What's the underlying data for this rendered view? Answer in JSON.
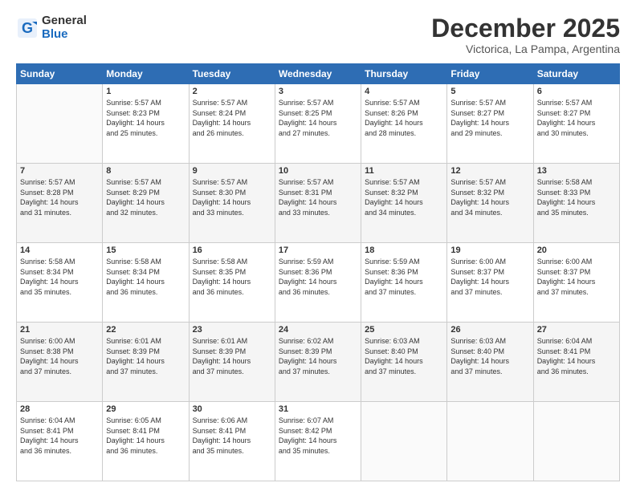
{
  "logo": {
    "general": "General",
    "blue": "Blue"
  },
  "header": {
    "month": "December 2025",
    "location": "Victorica, La Pampa, Argentina"
  },
  "days_of_week": [
    "Sunday",
    "Monday",
    "Tuesday",
    "Wednesday",
    "Thursday",
    "Friday",
    "Saturday"
  ],
  "weeks": [
    [
      {
        "num": "",
        "info": ""
      },
      {
        "num": "1",
        "info": "Sunrise: 5:57 AM\nSunset: 8:23 PM\nDaylight: 14 hours\nand 25 minutes."
      },
      {
        "num": "2",
        "info": "Sunrise: 5:57 AM\nSunset: 8:24 PM\nDaylight: 14 hours\nand 26 minutes."
      },
      {
        "num": "3",
        "info": "Sunrise: 5:57 AM\nSunset: 8:25 PM\nDaylight: 14 hours\nand 27 minutes."
      },
      {
        "num": "4",
        "info": "Sunrise: 5:57 AM\nSunset: 8:26 PM\nDaylight: 14 hours\nand 28 minutes."
      },
      {
        "num": "5",
        "info": "Sunrise: 5:57 AM\nSunset: 8:27 PM\nDaylight: 14 hours\nand 29 minutes."
      },
      {
        "num": "6",
        "info": "Sunrise: 5:57 AM\nSunset: 8:27 PM\nDaylight: 14 hours\nand 30 minutes."
      }
    ],
    [
      {
        "num": "7",
        "info": "Sunrise: 5:57 AM\nSunset: 8:28 PM\nDaylight: 14 hours\nand 31 minutes."
      },
      {
        "num": "8",
        "info": "Sunrise: 5:57 AM\nSunset: 8:29 PM\nDaylight: 14 hours\nand 32 minutes."
      },
      {
        "num": "9",
        "info": "Sunrise: 5:57 AM\nSunset: 8:30 PM\nDaylight: 14 hours\nand 33 minutes."
      },
      {
        "num": "10",
        "info": "Sunrise: 5:57 AM\nSunset: 8:31 PM\nDaylight: 14 hours\nand 33 minutes."
      },
      {
        "num": "11",
        "info": "Sunrise: 5:57 AM\nSunset: 8:32 PM\nDaylight: 14 hours\nand 34 minutes."
      },
      {
        "num": "12",
        "info": "Sunrise: 5:57 AM\nSunset: 8:32 PM\nDaylight: 14 hours\nand 34 minutes."
      },
      {
        "num": "13",
        "info": "Sunrise: 5:58 AM\nSunset: 8:33 PM\nDaylight: 14 hours\nand 35 minutes."
      }
    ],
    [
      {
        "num": "14",
        "info": "Sunrise: 5:58 AM\nSunset: 8:34 PM\nDaylight: 14 hours\nand 35 minutes."
      },
      {
        "num": "15",
        "info": "Sunrise: 5:58 AM\nSunset: 8:34 PM\nDaylight: 14 hours\nand 36 minutes."
      },
      {
        "num": "16",
        "info": "Sunrise: 5:58 AM\nSunset: 8:35 PM\nDaylight: 14 hours\nand 36 minutes."
      },
      {
        "num": "17",
        "info": "Sunrise: 5:59 AM\nSunset: 8:36 PM\nDaylight: 14 hours\nand 36 minutes."
      },
      {
        "num": "18",
        "info": "Sunrise: 5:59 AM\nSunset: 8:36 PM\nDaylight: 14 hours\nand 37 minutes."
      },
      {
        "num": "19",
        "info": "Sunrise: 6:00 AM\nSunset: 8:37 PM\nDaylight: 14 hours\nand 37 minutes."
      },
      {
        "num": "20",
        "info": "Sunrise: 6:00 AM\nSunset: 8:37 PM\nDaylight: 14 hours\nand 37 minutes."
      }
    ],
    [
      {
        "num": "21",
        "info": "Sunrise: 6:00 AM\nSunset: 8:38 PM\nDaylight: 14 hours\nand 37 minutes."
      },
      {
        "num": "22",
        "info": "Sunrise: 6:01 AM\nSunset: 8:39 PM\nDaylight: 14 hours\nand 37 minutes."
      },
      {
        "num": "23",
        "info": "Sunrise: 6:01 AM\nSunset: 8:39 PM\nDaylight: 14 hours\nand 37 minutes."
      },
      {
        "num": "24",
        "info": "Sunrise: 6:02 AM\nSunset: 8:39 PM\nDaylight: 14 hours\nand 37 minutes."
      },
      {
        "num": "25",
        "info": "Sunrise: 6:03 AM\nSunset: 8:40 PM\nDaylight: 14 hours\nand 37 minutes."
      },
      {
        "num": "26",
        "info": "Sunrise: 6:03 AM\nSunset: 8:40 PM\nDaylight: 14 hours\nand 37 minutes."
      },
      {
        "num": "27",
        "info": "Sunrise: 6:04 AM\nSunset: 8:41 PM\nDaylight: 14 hours\nand 36 minutes."
      }
    ],
    [
      {
        "num": "28",
        "info": "Sunrise: 6:04 AM\nSunset: 8:41 PM\nDaylight: 14 hours\nand 36 minutes."
      },
      {
        "num": "29",
        "info": "Sunrise: 6:05 AM\nSunset: 8:41 PM\nDaylight: 14 hours\nand 36 minutes."
      },
      {
        "num": "30",
        "info": "Sunrise: 6:06 AM\nSunset: 8:41 PM\nDaylight: 14 hours\nand 35 minutes."
      },
      {
        "num": "31",
        "info": "Sunrise: 6:07 AM\nSunset: 8:42 PM\nDaylight: 14 hours\nand 35 minutes."
      },
      {
        "num": "",
        "info": ""
      },
      {
        "num": "",
        "info": ""
      },
      {
        "num": "",
        "info": ""
      }
    ]
  ]
}
